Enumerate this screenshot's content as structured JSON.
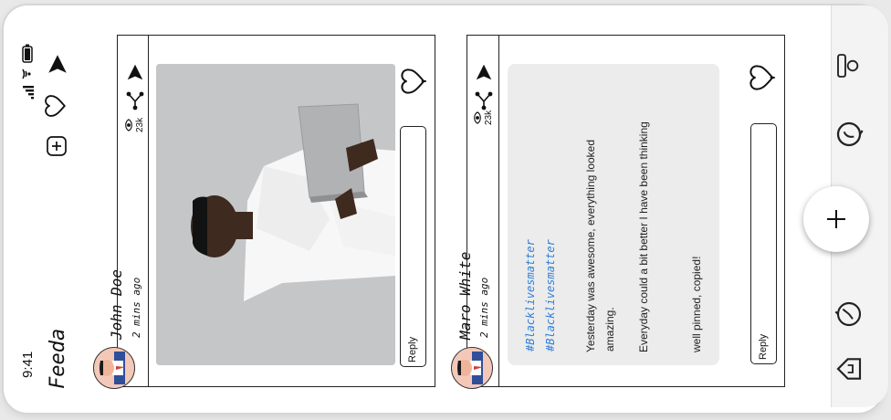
{
  "status": {
    "time": "9:41"
  },
  "app": {
    "title": "Feeda"
  },
  "posts": [
    {
      "author": "John Doe",
      "time": "2 mins ago",
      "views": "23k",
      "reply_label": "Reply"
    },
    {
      "author": "Maro White",
      "time": "2 mins ago",
      "views": "23k",
      "reply_label": "Reply",
      "hashtags": [
        "#Blacklivesmatter",
        "#Blacklivesmatter"
      ],
      "lines": [
        "Yesterday was awesome, everything looked",
        "amazing.",
        "Everyday could a bit better I have been thinking",
        "well pinned, copied!"
      ]
    }
  ],
  "colors": {
    "link": "#2f7fd9",
    "ink": "#222222"
  }
}
